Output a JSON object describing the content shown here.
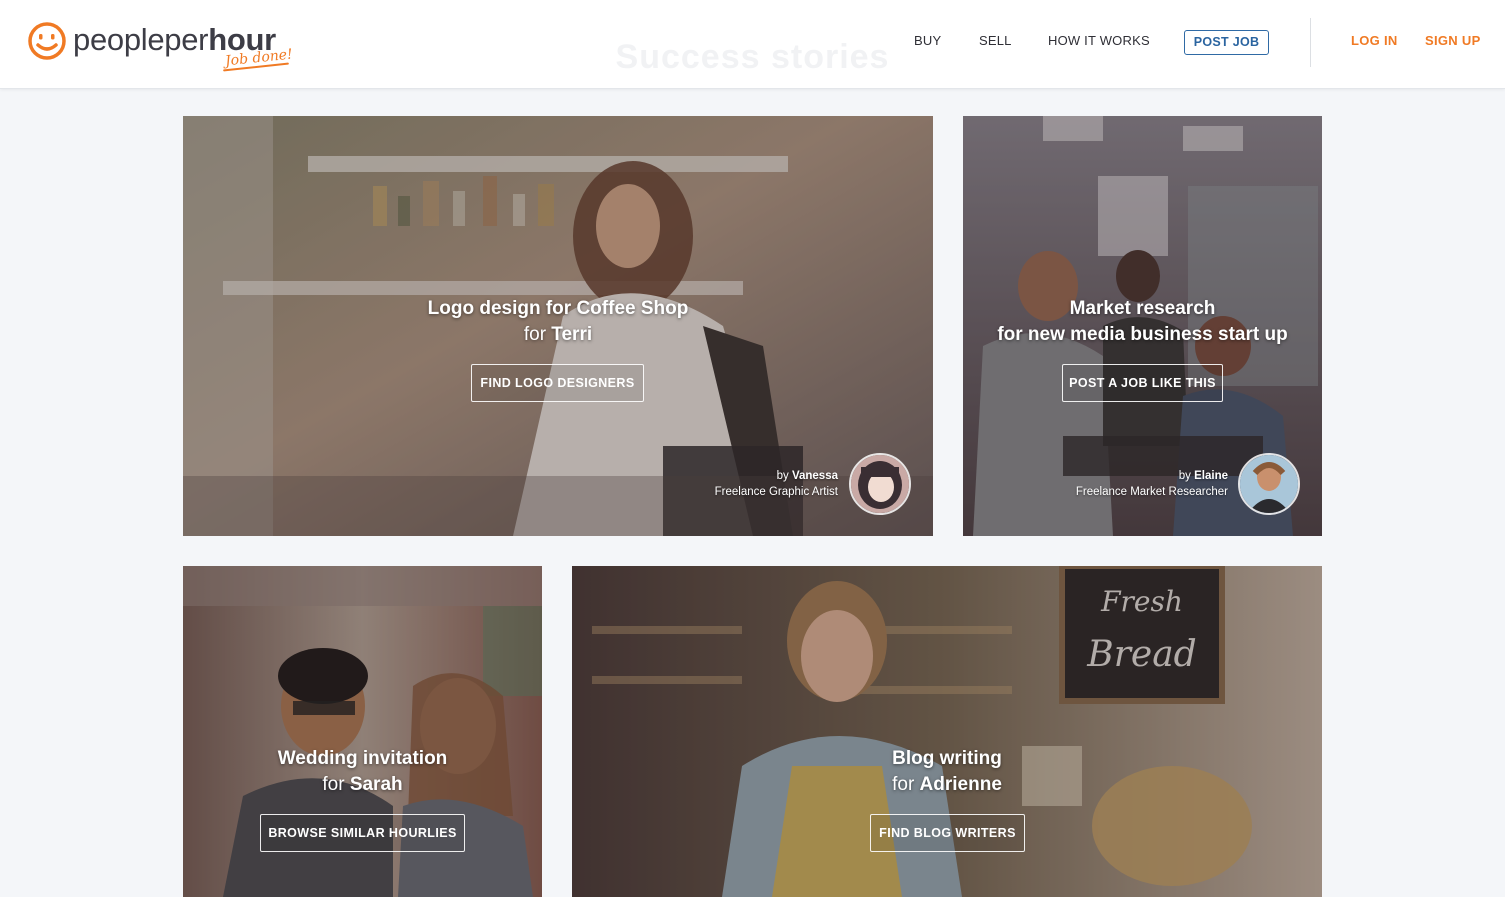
{
  "header": {
    "ghost_title": "Success stories",
    "logo": {
      "word_light": "people",
      "word_mid": "per",
      "word_bold": "hour",
      "tagline": "Job done!"
    },
    "nav": {
      "buy": "BUY",
      "sell": "SELL",
      "how_it_works": "HOW IT WORKS",
      "post_job": "POST JOB",
      "log_in": "LOG IN",
      "sign_up": "SIGN UP"
    }
  },
  "colors": {
    "accent_orange": "#f07a24",
    "accent_blue": "#2a64a0",
    "background": "#f4f6f9"
  },
  "cards": [
    {
      "title_line1": "Logo design for Coffee Shop",
      "title_line2_prefix": "for ",
      "title_line2_name": "Terri",
      "button": "FIND LOGO DESIGNERS",
      "credit_by": "by ",
      "credit_name": "Vanessa",
      "credit_role": "Freelance Graphic Artist"
    },
    {
      "title_line1": "Market research",
      "title_line2_prefix": "for new media business start up",
      "title_line2_name": "",
      "button": "POST A JOB LIKE THIS",
      "credit_by": "by ",
      "credit_name": "Elaine",
      "credit_role": "Freelance Market Researcher"
    },
    {
      "title_line1": "Wedding invitation",
      "title_line2_prefix": "for ",
      "title_line2_name": "Sarah",
      "button": "BROWSE SIMILAR HOURLIES"
    },
    {
      "title_line1": "Blog writing",
      "title_line2_prefix": "for ",
      "title_line2_name": "Adrienne",
      "button": "FIND BLOG WRITERS"
    }
  ]
}
